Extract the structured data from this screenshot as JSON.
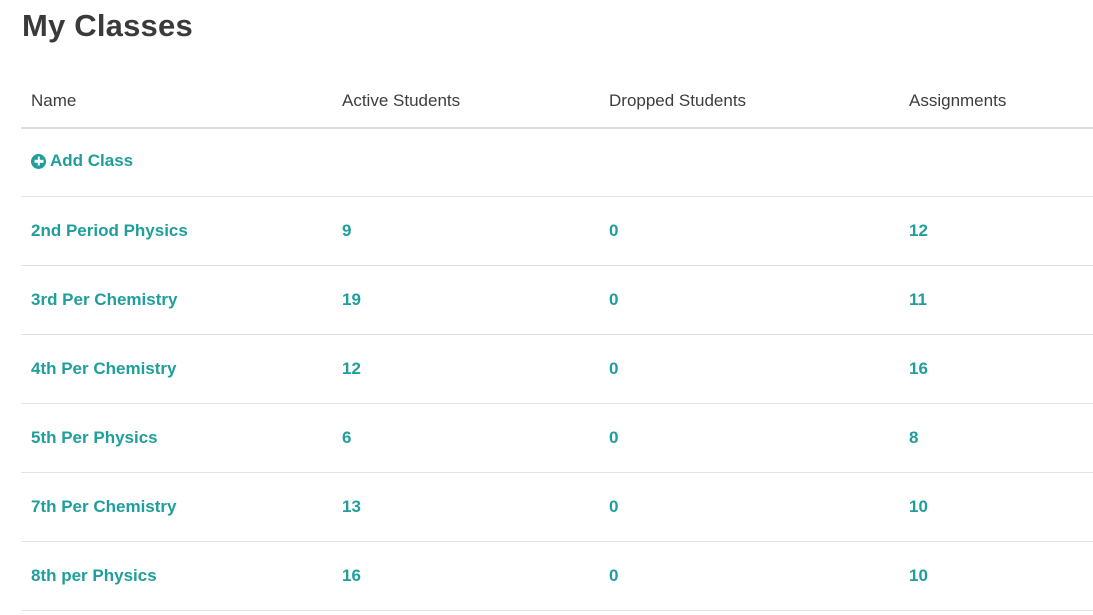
{
  "page": {
    "title": "My Classes"
  },
  "table": {
    "columns": [
      "Name",
      "Active Students",
      "Dropped Students",
      "Assignments"
    ],
    "add_class_label": "Add Class",
    "add_class_icon": "plus-circle-icon",
    "rows": [
      {
        "name": "2nd Period Physics",
        "active": "9",
        "dropped": "0",
        "assignments": "12"
      },
      {
        "name": "3rd Per Chemistry",
        "active": "19",
        "dropped": "0",
        "assignments": "11"
      },
      {
        "name": "4th Per Chemistry",
        "active": "12",
        "dropped": "0",
        "assignments": "16"
      },
      {
        "name": "5th Per Physics",
        "active": "6",
        "dropped": "0",
        "assignments": "8"
      },
      {
        "name": "7th Per Chemistry",
        "active": "13",
        "dropped": "0",
        "assignments": "10"
      },
      {
        "name": "8th per Physics",
        "active": "16",
        "dropped": "0",
        "assignments": "10"
      }
    ]
  },
  "colors": {
    "accent": "#1f9e9c",
    "title_text": "#3a3a3a",
    "header_text": "#3d3d3d",
    "divider": "#e3e3e3"
  }
}
